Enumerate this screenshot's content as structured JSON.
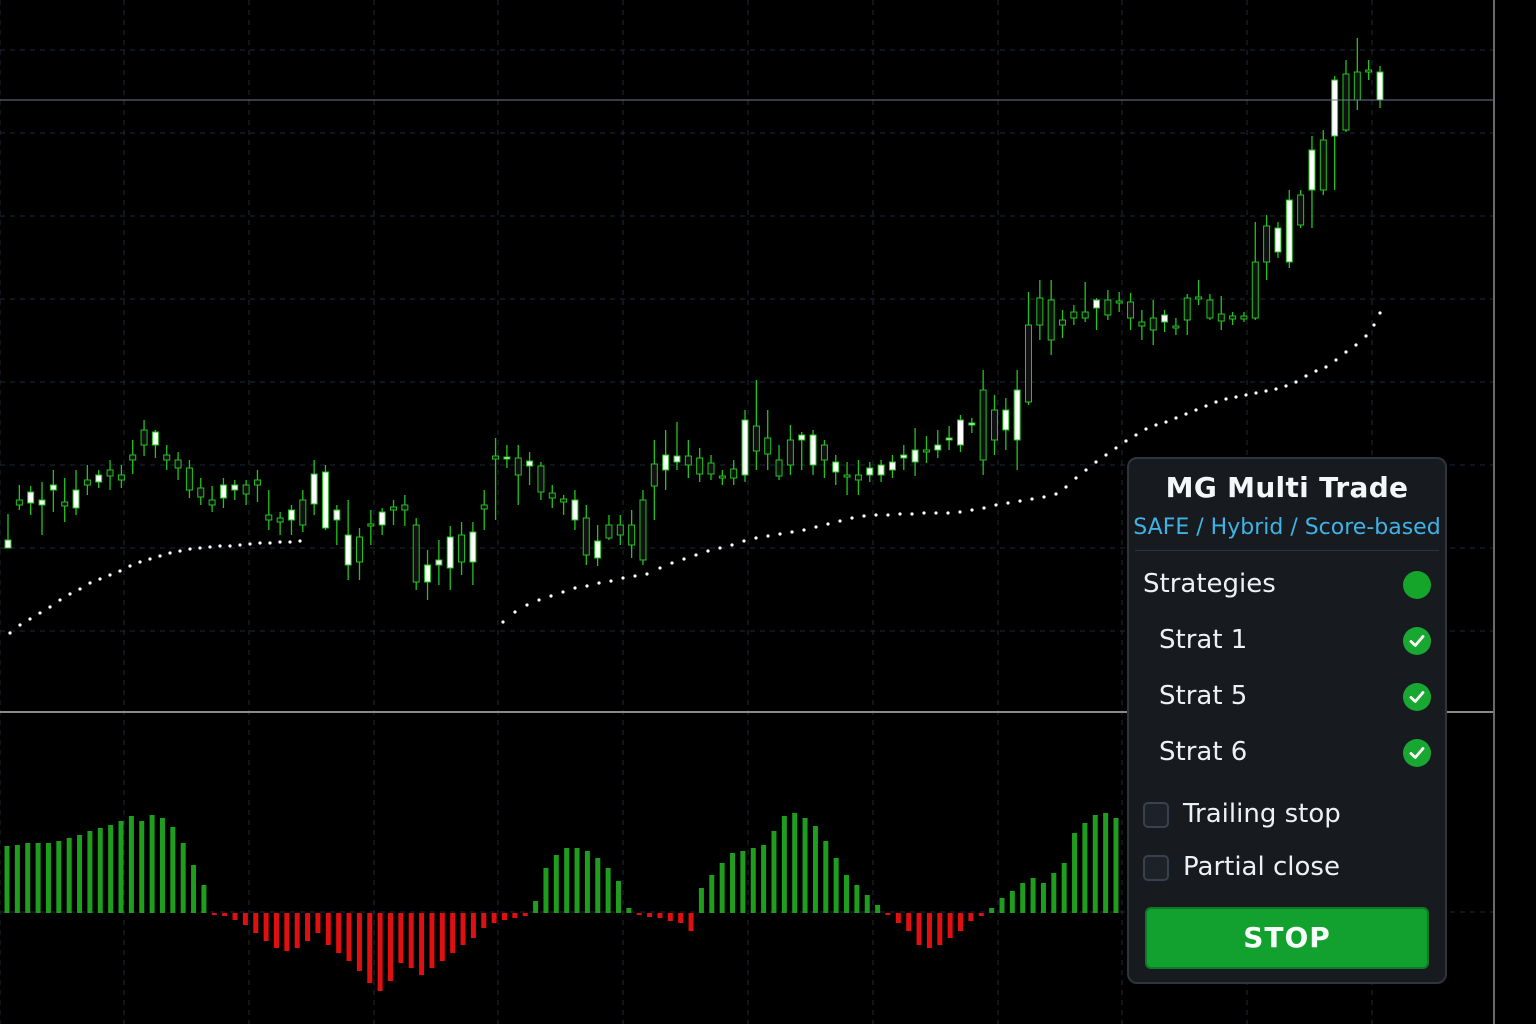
{
  "chart": {
    "colors": {
      "background": "#000000",
      "grid": "#1c2a3a",
      "candle_wick": "#22c51e",
      "candle_up_body": "#ffffff",
      "candle_down_body": "#111111",
      "psar_dots": "#ffffff",
      "hist_positive": "#1f9d1f",
      "hist_negative": "#e01010",
      "price_line": "#6e7a8e",
      "pane_separator": "#8a8a8a"
    },
    "candles": [
      [
        548,
        540,
        514,
        546
      ],
      [
        500,
        505,
        485,
        510
      ],
      [
        503,
        492,
        486,
        515
      ],
      [
        505,
        500,
        482,
        535
      ],
      [
        490,
        485,
        470,
        512
      ],
      [
        502,
        506,
        478,
        522
      ],
      [
        508,
        490,
        470,
        515
      ],
      [
        480,
        485,
        465,
        495
      ],
      [
        482,
        475,
        470,
        488
      ],
      [
        470,
        476,
        460,
        490
      ],
      [
        475,
        480,
        465,
        488
      ],
      [
        455,
        460,
        440,
        474
      ],
      [
        430,
        445,
        420,
        456
      ],
      [
        445,
        432,
        430,
        458
      ],
      [
        455,
        460,
        445,
        470
      ],
      [
        460,
        468,
        452,
        480
      ],
      [
        468,
        490,
        460,
        498
      ],
      [
        488,
        497,
        478,
        505
      ],
      [
        500,
        505,
        486,
        512
      ],
      [
        498,
        485,
        478,
        508
      ],
      [
        490,
        485,
        480,
        500
      ],
      [
        485,
        494,
        480,
        505
      ],
      [
        480,
        485,
        470,
        502
      ],
      [
        515,
        520,
        490,
        530
      ],
      [
        518,
        522,
        512,
        535
      ],
      [
        520,
        510,
        505,
        535
      ],
      [
        500,
        525,
        490,
        532
      ],
      [
        504,
        474,
        460,
        515
      ],
      [
        528,
        472,
        465,
        530
      ],
      [
        520,
        510,
        505,
        545
      ],
      [
        565,
        535,
        500,
        580
      ],
      [
        537,
        562,
        528,
        580
      ],
      [
        524,
        524,
        510,
        545
      ],
      [
        525,
        512,
        508,
        535
      ],
      [
        507,
        510,
        500,
        525
      ],
      [
        505,
        510,
        495,
        526
      ],
      [
        525,
        582,
        518,
        590
      ],
      [
        582,
        565,
        550,
        600
      ],
      [
        565,
        560,
        540,
        585
      ],
      [
        568,
        537,
        526,
        590
      ],
      [
        535,
        562,
        522,
        575
      ],
      [
        562,
        532,
        522,
        585
      ],
      [
        505,
        509,
        490,
        530
      ],
      [
        456,
        459,
        438,
        520
      ],
      [
        458,
        457,
        445,
        468
      ],
      [
        458,
        475,
        445,
        505
      ],
      [
        466,
        461,
        452,
        485
      ],
      [
        466,
        492,
        462,
        500
      ],
      [
        493,
        498,
        485,
        508
      ],
      [
        499,
        502,
        495,
        515
      ],
      [
        520,
        500,
        490,
        530
      ],
      [
        518,
        555,
        505,
        565
      ],
      [
        558,
        541,
        525,
        566
      ],
      [
        525,
        538,
        515,
        540
      ],
      [
        525,
        535,
        515,
        545
      ],
      [
        525,
        545,
        510,
        558
      ],
      [
        500,
        560,
        490,
        565
      ],
      [
        464,
        486,
        440,
        520
      ],
      [
        470,
        455,
        430,
        490
      ],
      [
        462,
        456,
        422,
        470
      ],
      [
        456,
        465,
        440,
        478
      ],
      [
        458,
        474,
        448,
        482
      ],
      [
        463,
        474,
        455,
        480
      ],
      [
        476,
        476,
        470,
        485
      ],
      [
        469,
        478,
        460,
        485
      ],
      [
        475,
        420,
        410,
        482
      ],
      [
        426,
        451,
        380,
        470
      ],
      [
        438,
        454,
        410,
        470
      ],
      [
        460,
        476,
        445,
        480
      ],
      [
        440,
        465,
        425,
        475
      ],
      [
        440,
        435,
        432,
        470
      ],
      [
        465,
        435,
        430,
        475
      ],
      [
        445,
        460,
        440,
        478
      ],
      [
        472,
        462,
        455,
        485
      ],
      [
        475,
        476,
        462,
        495
      ],
      [
        475,
        480,
        460,
        495
      ],
      [
        475,
        468,
        462,
        482
      ],
      [
        475,
        465,
        460,
        482
      ],
      [
        470,
        462,
        455,
        478
      ],
      [
        458,
        455,
        445,
        470
      ],
      [
        462,
        450,
        428,
        476
      ],
      [
        450,
        452,
        436,
        463
      ],
      [
        450,
        445,
        430,
        458
      ],
      [
        440,
        438,
        426,
        450
      ],
      [
        445,
        420,
        415,
        452
      ],
      [
        425,
        423,
        418,
        433
      ],
      [
        390,
        460,
        370,
        475
      ],
      [
        410,
        440,
        395,
        455
      ],
      [
        430,
        410,
        398,
        450
      ],
      [
        440,
        390,
        370,
        470
      ],
      [
        325,
        402,
        292,
        405
      ],
      [
        298,
        325,
        280,
        340
      ],
      [
        300,
        340,
        280,
        355
      ],
      [
        320,
        325,
        310,
        338
      ],
      [
        312,
        318,
        305,
        325
      ],
      [
        312,
        318,
        282,
        322
      ],
      [
        308,
        300,
        298,
        330
      ],
      [
        300,
        315,
        290,
        320
      ],
      [
        301,
        301,
        292,
        312
      ],
      [
        302,
        318,
        293,
        330
      ],
      [
        322,
        326,
        310,
        340
      ],
      [
        318,
        330,
        300,
        345
      ],
      [
        322,
        315,
        310,
        332
      ],
      [
        326,
        328,
        318,
        335
      ],
      [
        298,
        320,
        294,
        335
      ],
      [
        297,
        297,
        280,
        305
      ],
      [
        300,
        318,
        294,
        320
      ],
      [
        314,
        321,
        296,
        330
      ],
      [
        316,
        319,
        312,
        325
      ],
      [
        316,
        319,
        312,
        322
      ],
      [
        262,
        318,
        222,
        320
      ],
      [
        226,
        262,
        215,
        280
      ],
      [
        252,
        228,
        222,
        258
      ],
      [
        262,
        200,
        190,
        268
      ],
      [
        195,
        225,
        190,
        228
      ],
      [
        190,
        150,
        136,
        228
      ],
      [
        140,
        190,
        130,
        195
      ],
      [
        136,
        80,
        76,
        190
      ],
      [
        74,
        130,
        60,
        132
      ],
      [
        72,
        100,
        38,
        110
      ],
      [
        70,
        72,
        60,
        80
      ],
      [
        100,
        72,
        66,
        108
      ]
    ],
    "psar": [
      [
        10,
        633
      ],
      [
        20,
        625
      ],
      [
        30,
        619
      ],
      [
        40,
        613
      ],
      [
        50,
        607
      ],
      [
        60,
        600
      ],
      [
        70,
        594
      ],
      [
        80,
        589
      ],
      [
        90,
        583
      ],
      [
        100,
        579
      ],
      [
        110,
        575
      ],
      [
        120,
        571
      ],
      [
        130,
        566
      ],
      [
        140,
        562
      ],
      [
        150,
        559
      ],
      [
        160,
        556
      ],
      [
        170,
        553
      ],
      [
        180,
        551
      ],
      [
        190,
        549
      ],
      [
        200,
        548
      ],
      [
        210,
        547
      ],
      [
        220,
        546
      ],
      [
        230,
        546
      ],
      [
        240,
        545
      ],
      [
        250,
        544
      ],
      [
        260,
        543
      ],
      [
        270,
        543
      ],
      [
        280,
        542
      ],
      [
        290,
        542
      ],
      [
        300,
        541
      ],
      [
        503,
        622
      ],
      [
        515,
        612
      ],
      [
        527,
        605
      ],
      [
        539,
        600
      ],
      [
        551,
        596
      ],
      [
        563,
        592
      ],
      [
        575,
        588
      ],
      [
        587,
        586
      ],
      [
        599,
        583
      ],
      [
        611,
        581
      ],
      [
        623,
        578
      ],
      [
        635,
        576
      ],
      [
        647,
        574
      ],
      [
        660,
        568
      ],
      [
        672,
        563
      ],
      [
        684,
        559
      ],
      [
        696,
        555
      ],
      [
        708,
        551
      ],
      [
        720,
        548
      ],
      [
        732,
        545
      ],
      [
        744,
        541
      ],
      [
        756,
        538
      ],
      [
        768,
        536
      ],
      [
        780,
        534
      ],
      [
        792,
        532
      ],
      [
        804,
        530
      ],
      [
        816,
        527
      ],
      [
        828,
        524
      ],
      [
        840,
        521
      ],
      [
        852,
        518
      ],
      [
        864,
        516
      ],
      [
        876,
        515
      ],
      [
        888,
        515
      ],
      [
        900,
        514
      ],
      [
        912,
        514
      ],
      [
        924,
        513
      ],
      [
        936,
        513
      ],
      [
        948,
        513
      ],
      [
        960,
        512
      ],
      [
        972,
        510
      ],
      [
        984,
        508
      ],
      [
        996,
        505
      ],
      [
        1008,
        503
      ],
      [
        1020,
        501
      ],
      [
        1032,
        499
      ],
      [
        1044,
        497
      ],
      [
        1056,
        494
      ],
      [
        1066,
        487
      ],
      [
        1076,
        478
      ],
      [
        1086,
        470
      ],
      [
        1096,
        462
      ],
      [
        1106,
        455
      ],
      [
        1116,
        448
      ],
      [
        1126,
        441
      ],
      [
        1136,
        435
      ],
      [
        1146,
        429
      ],
      [
        1156,
        425
      ],
      [
        1166,
        422
      ],
      [
        1176,
        418
      ],
      [
        1186,
        414
      ],
      [
        1196,
        410
      ],
      [
        1206,
        406
      ],
      [
        1216,
        402
      ],
      [
        1226,
        399
      ],
      [
        1236,
        397
      ],
      [
        1246,
        395
      ],
      [
        1256,
        393
      ],
      [
        1266,
        391
      ],
      [
        1276,
        389
      ],
      [
        1286,
        386
      ],
      [
        1296,
        382
      ],
      [
        1306,
        376
      ],
      [
        1316,
        371
      ],
      [
        1326,
        367
      ],
      [
        1336,
        360
      ],
      [
        1346,
        352
      ],
      [
        1356,
        345
      ],
      [
        1366,
        336
      ],
      [
        1374,
        325
      ],
      [
        1380,
        313
      ]
    ],
    "histogram": [
      [
        "+",
        67
      ],
      [
        "+",
        68
      ],
      [
        "+",
        70
      ],
      [
        "+",
        70
      ],
      [
        "+",
        70
      ],
      [
        "+",
        72
      ],
      [
        "+",
        75
      ],
      [
        "+",
        78
      ],
      [
        "+",
        82
      ],
      [
        "+",
        85
      ],
      [
        "+",
        88
      ],
      [
        "+",
        92
      ],
      [
        "+",
        97
      ],
      [
        "+",
        92
      ],
      [
        "+",
        98
      ],
      [
        "+",
        95
      ],
      [
        "+",
        86
      ],
      [
        "+",
        70
      ],
      [
        "+",
        48
      ],
      [
        "+",
        28
      ],
      [
        "-",
        2
      ],
      [
        "-",
        3
      ],
      [
        "-",
        7
      ],
      [
        "-",
        12
      ],
      [
        "-",
        20
      ],
      [
        "-",
        28
      ],
      [
        "-",
        35
      ],
      [
        "-",
        38
      ],
      [
        "-",
        35
      ],
      [
        "-",
        28
      ],
      [
        "-",
        20
      ],
      [
        "-",
        32
      ],
      [
        "-",
        40
      ],
      [
        "-",
        48
      ],
      [
        "-",
        58
      ],
      [
        "-",
        70
      ],
      [
        "-",
        78
      ],
      [
        "-",
        68
      ],
      [
        "-",
        50
      ],
      [
        "-",
        55
      ],
      [
        "-",
        62
      ],
      [
        "-",
        55
      ],
      [
        "-",
        48
      ],
      [
        "-",
        40
      ],
      [
        "-",
        32
      ],
      [
        "-",
        25
      ],
      [
        "-",
        15
      ],
      [
        "-",
        10
      ],
      [
        "-",
        7
      ],
      [
        "-",
        5
      ],
      [
        "-",
        3
      ],
      [
        "+",
        12
      ],
      [
        "+",
        45
      ],
      [
        "+",
        58
      ],
      [
        "+",
        65
      ],
      [
        "+",
        65
      ],
      [
        "+",
        62
      ],
      [
        "+",
        55
      ],
      [
        "+",
        45
      ],
      [
        "+",
        32
      ],
      [
        "+",
        5
      ],
      [
        "-",
        2
      ],
      [
        "-",
        4
      ],
      [
        "-",
        5
      ],
      [
        "-",
        8
      ],
      [
        "-",
        10
      ],
      [
        "-",
        18
      ],
      [
        "+",
        25
      ],
      [
        "+",
        38
      ],
      [
        "+",
        50
      ],
      [
        "+",
        60
      ],
      [
        "+",
        62
      ],
      [
        "+",
        65
      ],
      [
        "+",
        68
      ],
      [
        "+",
        82
      ],
      [
        "+",
        97
      ],
      [
        "+",
        100
      ],
      [
        "+",
        95
      ],
      [
        "+",
        87
      ],
      [
        "+",
        72
      ],
      [
        "+",
        55
      ],
      [
        "+",
        38
      ],
      [
        "+",
        28
      ],
      [
        "+",
        18
      ],
      [
        "+",
        8
      ],
      [
        "-",
        2
      ],
      [
        "-",
        10
      ],
      [
        "-",
        18
      ],
      [
        "-",
        32
      ],
      [
        "-",
        35
      ],
      [
        "-",
        32
      ],
      [
        "-",
        25
      ],
      [
        "-",
        18
      ],
      [
        "-",
        8
      ],
      [
        "-",
        3
      ],
      [
        "+",
        5
      ],
      [
        "+",
        15
      ],
      [
        "+",
        22
      ],
      [
        "+",
        30
      ],
      [
        "+",
        35
      ],
      [
        "+",
        30
      ],
      [
        "+",
        40
      ],
      [
        "+",
        50
      ],
      [
        "+",
        80
      ],
      [
        "+",
        90
      ],
      [
        "+",
        98
      ],
      [
        "+",
        100
      ],
      [
        "+",
        95
      ]
    ]
  },
  "panel": {
    "title": "MG Multi Trade",
    "subtitle": "SAFE / Hybrid / Score-based",
    "strategies_label": "Strategies",
    "strategies": [
      "Strat 1",
      "Strat 5",
      "Strat 6"
    ],
    "options": {
      "trailing_stop": "Trailing stop",
      "partial_close": "Partial close"
    },
    "stop_label": "STOP",
    "accent": "#3fb2e6",
    "button_color": "#12a02f",
    "status_icon": "status-dot-icon",
    "check_icon": "check-circle-icon"
  }
}
